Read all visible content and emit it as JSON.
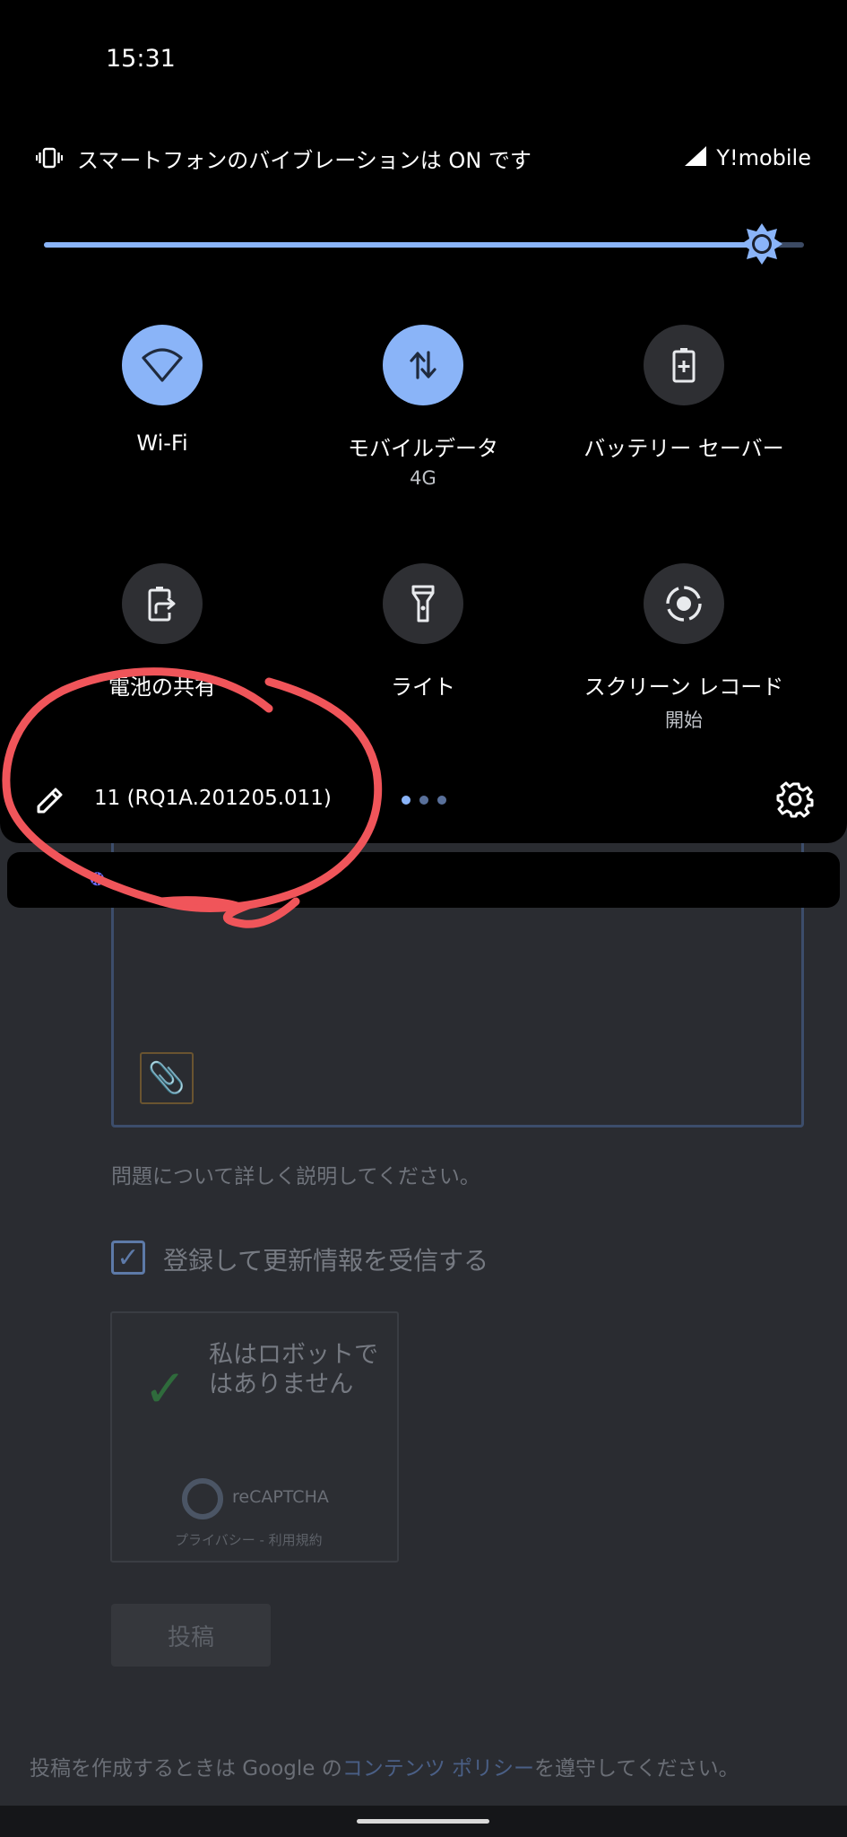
{
  "status_bar": {
    "time": "15:31"
  },
  "header": {
    "vibration_text": "スマートフォンのバイブレーションは ON です",
    "carrier": "Y!mobile"
  },
  "brightness": {
    "level": 0.95
  },
  "tiles": [
    {
      "label": "Wi-Fi",
      "sub": "",
      "state": "on",
      "icon": "wifi-icon"
    },
    {
      "label": "モバイルデータ",
      "sub": "4G",
      "state": "on",
      "icon": "mobile-data-icon"
    },
    {
      "label": "バッテリー セーバー",
      "sub": "",
      "state": "off",
      "icon": "battery-saver-icon"
    },
    {
      "label": "電池の共有",
      "sub": "",
      "state": "off",
      "icon": "battery-share-icon"
    },
    {
      "label": "ライト",
      "sub": "",
      "state": "off",
      "icon": "flashlight-icon"
    },
    {
      "label": "スクリーン レコード",
      "sub": "開始",
      "state": "off",
      "icon": "screen-record-icon"
    }
  ],
  "footer": {
    "build": "11 (RQ1A.201205.011)",
    "pages": 3,
    "current_page": 1
  },
  "background_page": {
    "help_text": "問題について詳しく説明してください。",
    "subscribe_label": "登録して更新情報を受信する",
    "captcha_text": "私はロボットではありません",
    "captcha_brand": "reCAPTCHA",
    "captcha_links": "プライバシー - 利用規約",
    "submit_label": "投稿",
    "policy_before": "投稿を作成するときは Google の",
    "policy_link": "コンテンツ ポリシー",
    "policy_after": "を遵守してください。"
  },
  "colors": {
    "accent": "#8ab4f8",
    "tile_off": "#2e2f33",
    "annotation": "#f0555a"
  }
}
